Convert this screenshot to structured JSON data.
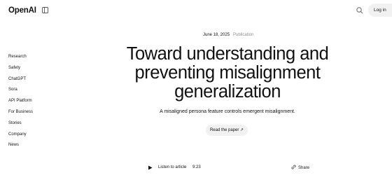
{
  "header": {
    "logo": "OpenAI",
    "login_label": "Log in"
  },
  "nav": {
    "items": [
      "Research",
      "Safety",
      "ChatGPT",
      "Sora",
      "API Platform",
      "For Business",
      "Stories",
      "Company",
      "News"
    ]
  },
  "article": {
    "date": "June 18, 2025",
    "category": "Publication",
    "title": "Toward understanding and preventing misalignment generalization",
    "subtitle": "A misaligned persona feature controls emergent misalignment.",
    "read_paper_label": "Read the paper ↗",
    "listen_label": "Listen to article",
    "duration": "9:23",
    "share_label": "Share"
  },
  "icons": {
    "sidebar": "sidebar-toggle-icon",
    "search": "search-icon",
    "play": "play-icon",
    "share": "link-icon"
  }
}
